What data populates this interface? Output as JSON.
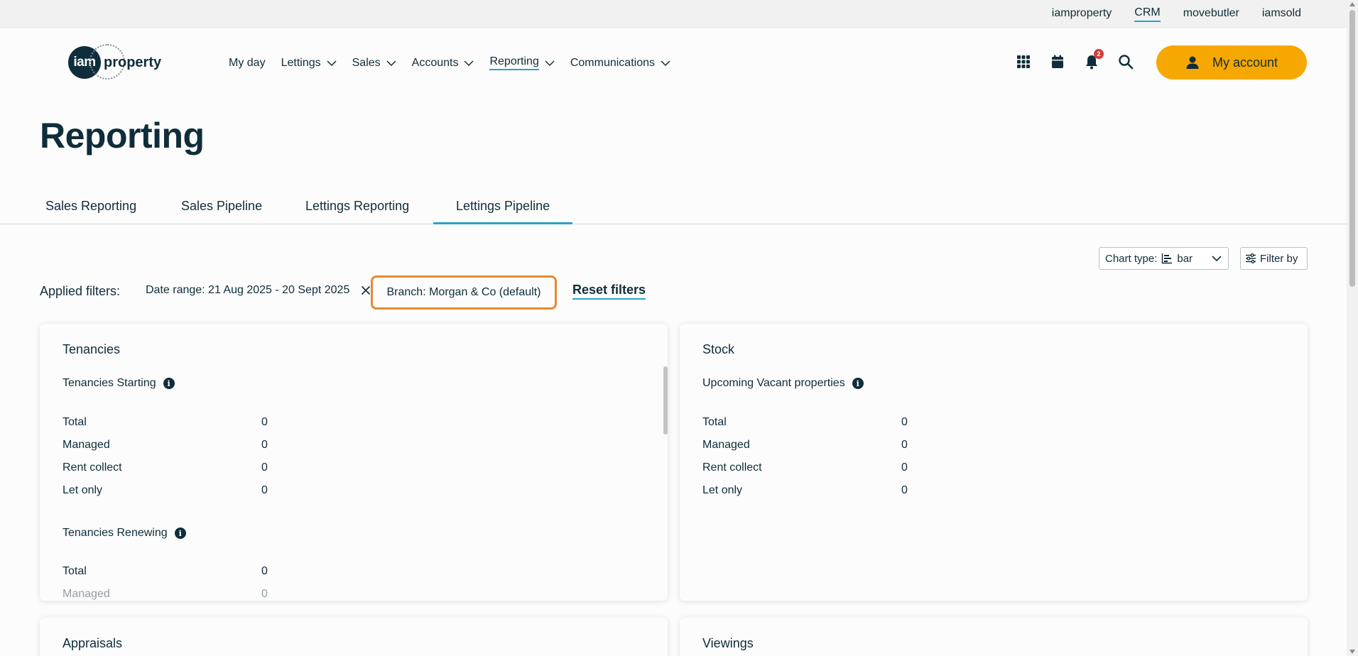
{
  "brandbar": {
    "links": [
      "iamproperty",
      "CRM",
      "movebutler",
      "iamsold"
    ],
    "active": "CRM"
  },
  "logo": {
    "mark": "iam",
    "word": "property"
  },
  "nav": {
    "items": [
      {
        "label": "My day"
      },
      {
        "label": "Lettings"
      },
      {
        "label": "Sales"
      },
      {
        "label": "Accounts"
      },
      {
        "label": "Reporting"
      },
      {
        "label": "Communications"
      }
    ],
    "active": "Reporting"
  },
  "header": {
    "notification_count": "2",
    "account_label": "My account"
  },
  "page": {
    "title": "Reporting"
  },
  "tabs": {
    "items": [
      "Sales Reporting",
      "Sales Pipeline",
      "Lettings Reporting",
      "Lettings Pipeline"
    ],
    "active": "Lettings Pipeline"
  },
  "controls": {
    "chart_type_label": "Chart type:",
    "chart_type_value": "bar",
    "filter_by_label": "Filter by"
  },
  "filters": {
    "applied_label": "Applied filters:",
    "date_range": "Date range: 21 Aug 2025 - 20 Sept 2025",
    "branch": "Branch: Morgan & Co (default)",
    "reset_label": "Reset filters"
  },
  "cards": {
    "tenancies": {
      "title": "Tenancies",
      "starting": {
        "title": "Tenancies Starting",
        "rows": [
          {
            "label": "Total",
            "value": "0"
          },
          {
            "label": "Managed",
            "value": "0"
          },
          {
            "label": "Rent collect",
            "value": "0"
          },
          {
            "label": "Let only",
            "value": "0"
          }
        ]
      },
      "renewing": {
        "title": "Tenancies Renewing",
        "rows": [
          {
            "label": "Total",
            "value": "0"
          },
          {
            "label": "Managed",
            "value": "0"
          }
        ]
      }
    },
    "stock": {
      "title": "Stock",
      "vacant": {
        "title": "Upcoming Vacant properties",
        "rows": [
          {
            "label": "Total",
            "value": "0"
          },
          {
            "label": "Managed",
            "value": "0"
          },
          {
            "label": "Rent collect",
            "value": "0"
          },
          {
            "label": "Let only",
            "value": "0"
          }
        ]
      }
    },
    "appraisals": {
      "title": "Appraisals"
    },
    "viewings": {
      "title": "Viewings"
    }
  },
  "colors": {
    "primary_text": "#0f2d3a",
    "accent_underline": "#2aa3c6",
    "account_button": "#f6a800",
    "highlight_border": "#e48a32",
    "badge": "#d63c3c"
  }
}
